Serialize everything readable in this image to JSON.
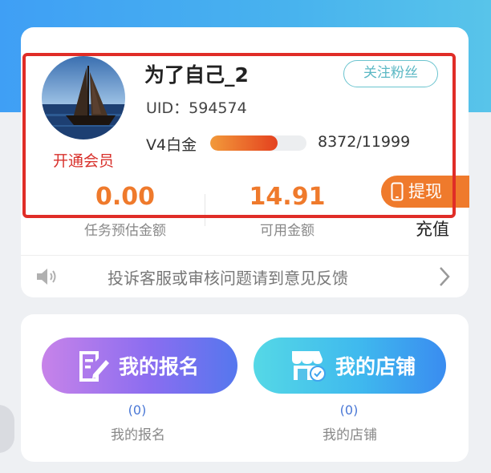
{
  "profile": {
    "username": "为了自己_2",
    "uid_label": "UID：",
    "uid": "594574",
    "vip_link": "开通会员",
    "follow_button": "关注粉丝",
    "level": "V4白金",
    "progress_text": "8372/11999",
    "progress_fraction": 0.698
  },
  "stats": {
    "estimated_amount": "0.00",
    "estimated_label": "任务预估金额",
    "available_amount": "14.91",
    "available_label": "可用金额",
    "withdraw_button": "提现",
    "recharge_button": "充值"
  },
  "notice": {
    "text": "投诉客服或审核问题请到意见反馈"
  },
  "actions": [
    {
      "label": "我的报名",
      "count": "(0)",
      "caption": "我的报名",
      "icon": "edit-document-icon"
    },
    {
      "label": "我的店铺",
      "count": "(0)",
      "caption": "我的店铺",
      "icon": "storefront-icon"
    }
  ],
  "colors": {
    "accent_orange": "#ef7a2c",
    "header_blue": "#3f9ff5",
    "highlight_red": "#e02d27",
    "follow_teal": "#5bb8c4"
  }
}
